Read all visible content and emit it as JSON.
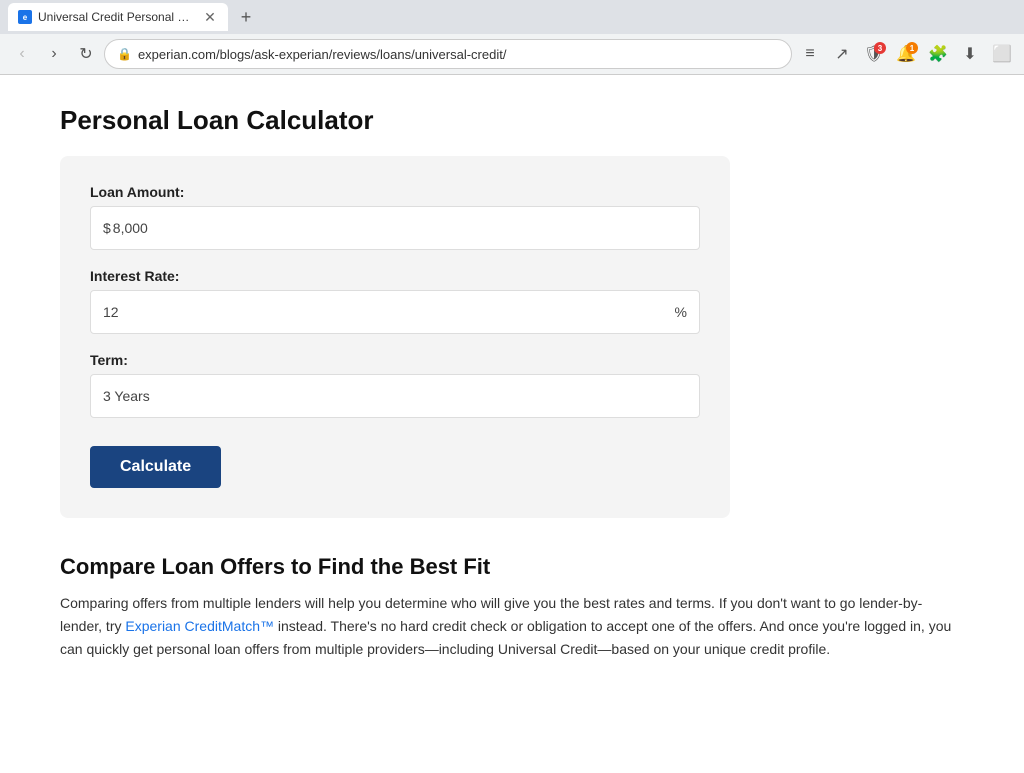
{
  "browser": {
    "tab": {
      "title": "Universal Credit Personal Loan Re",
      "favicon_letter": "e"
    },
    "new_tab_label": "+",
    "nav": {
      "back_label": "‹",
      "forward_label": "›",
      "reload_label": "↻"
    },
    "address": "experian.com/blogs/ask-experian/reviews/loans/universal-credit/",
    "toolbar_icons": {
      "menu": "≡",
      "share": "↗",
      "shield_label": "🛡",
      "bell_label": "🔔",
      "puzzle_label": "🧩",
      "download_label": "⬇",
      "window_label": "⬜"
    },
    "shield_badge": "3",
    "bell_badge": "1"
  },
  "page": {
    "calculator": {
      "title": "Personal Loan Calculator",
      "loan_amount": {
        "label": "Loan Amount:",
        "prefix": "$",
        "value": "8,000"
      },
      "interest_rate": {
        "label": "Interest Rate:",
        "value": "12",
        "suffix": "%"
      },
      "term": {
        "label": "Term:",
        "value": "3 Years"
      },
      "calculate_button": "Calculate"
    },
    "compare_section": {
      "title": "Compare Loan Offers to Find the Best Fit",
      "text_part1": "Comparing offers from multiple lenders will help you determine who will give you the best rates and terms. If you don't want to go lender-by-lender, try ",
      "link_text": "Experian CreditMatch™",
      "link_href": "#",
      "text_part2": " instead. There's no hard credit check or obligation to accept one of the offers. And once you're logged in, you can quickly get personal loan offers from multiple providers—including Universal Credit—based on your unique credit profile."
    }
  }
}
